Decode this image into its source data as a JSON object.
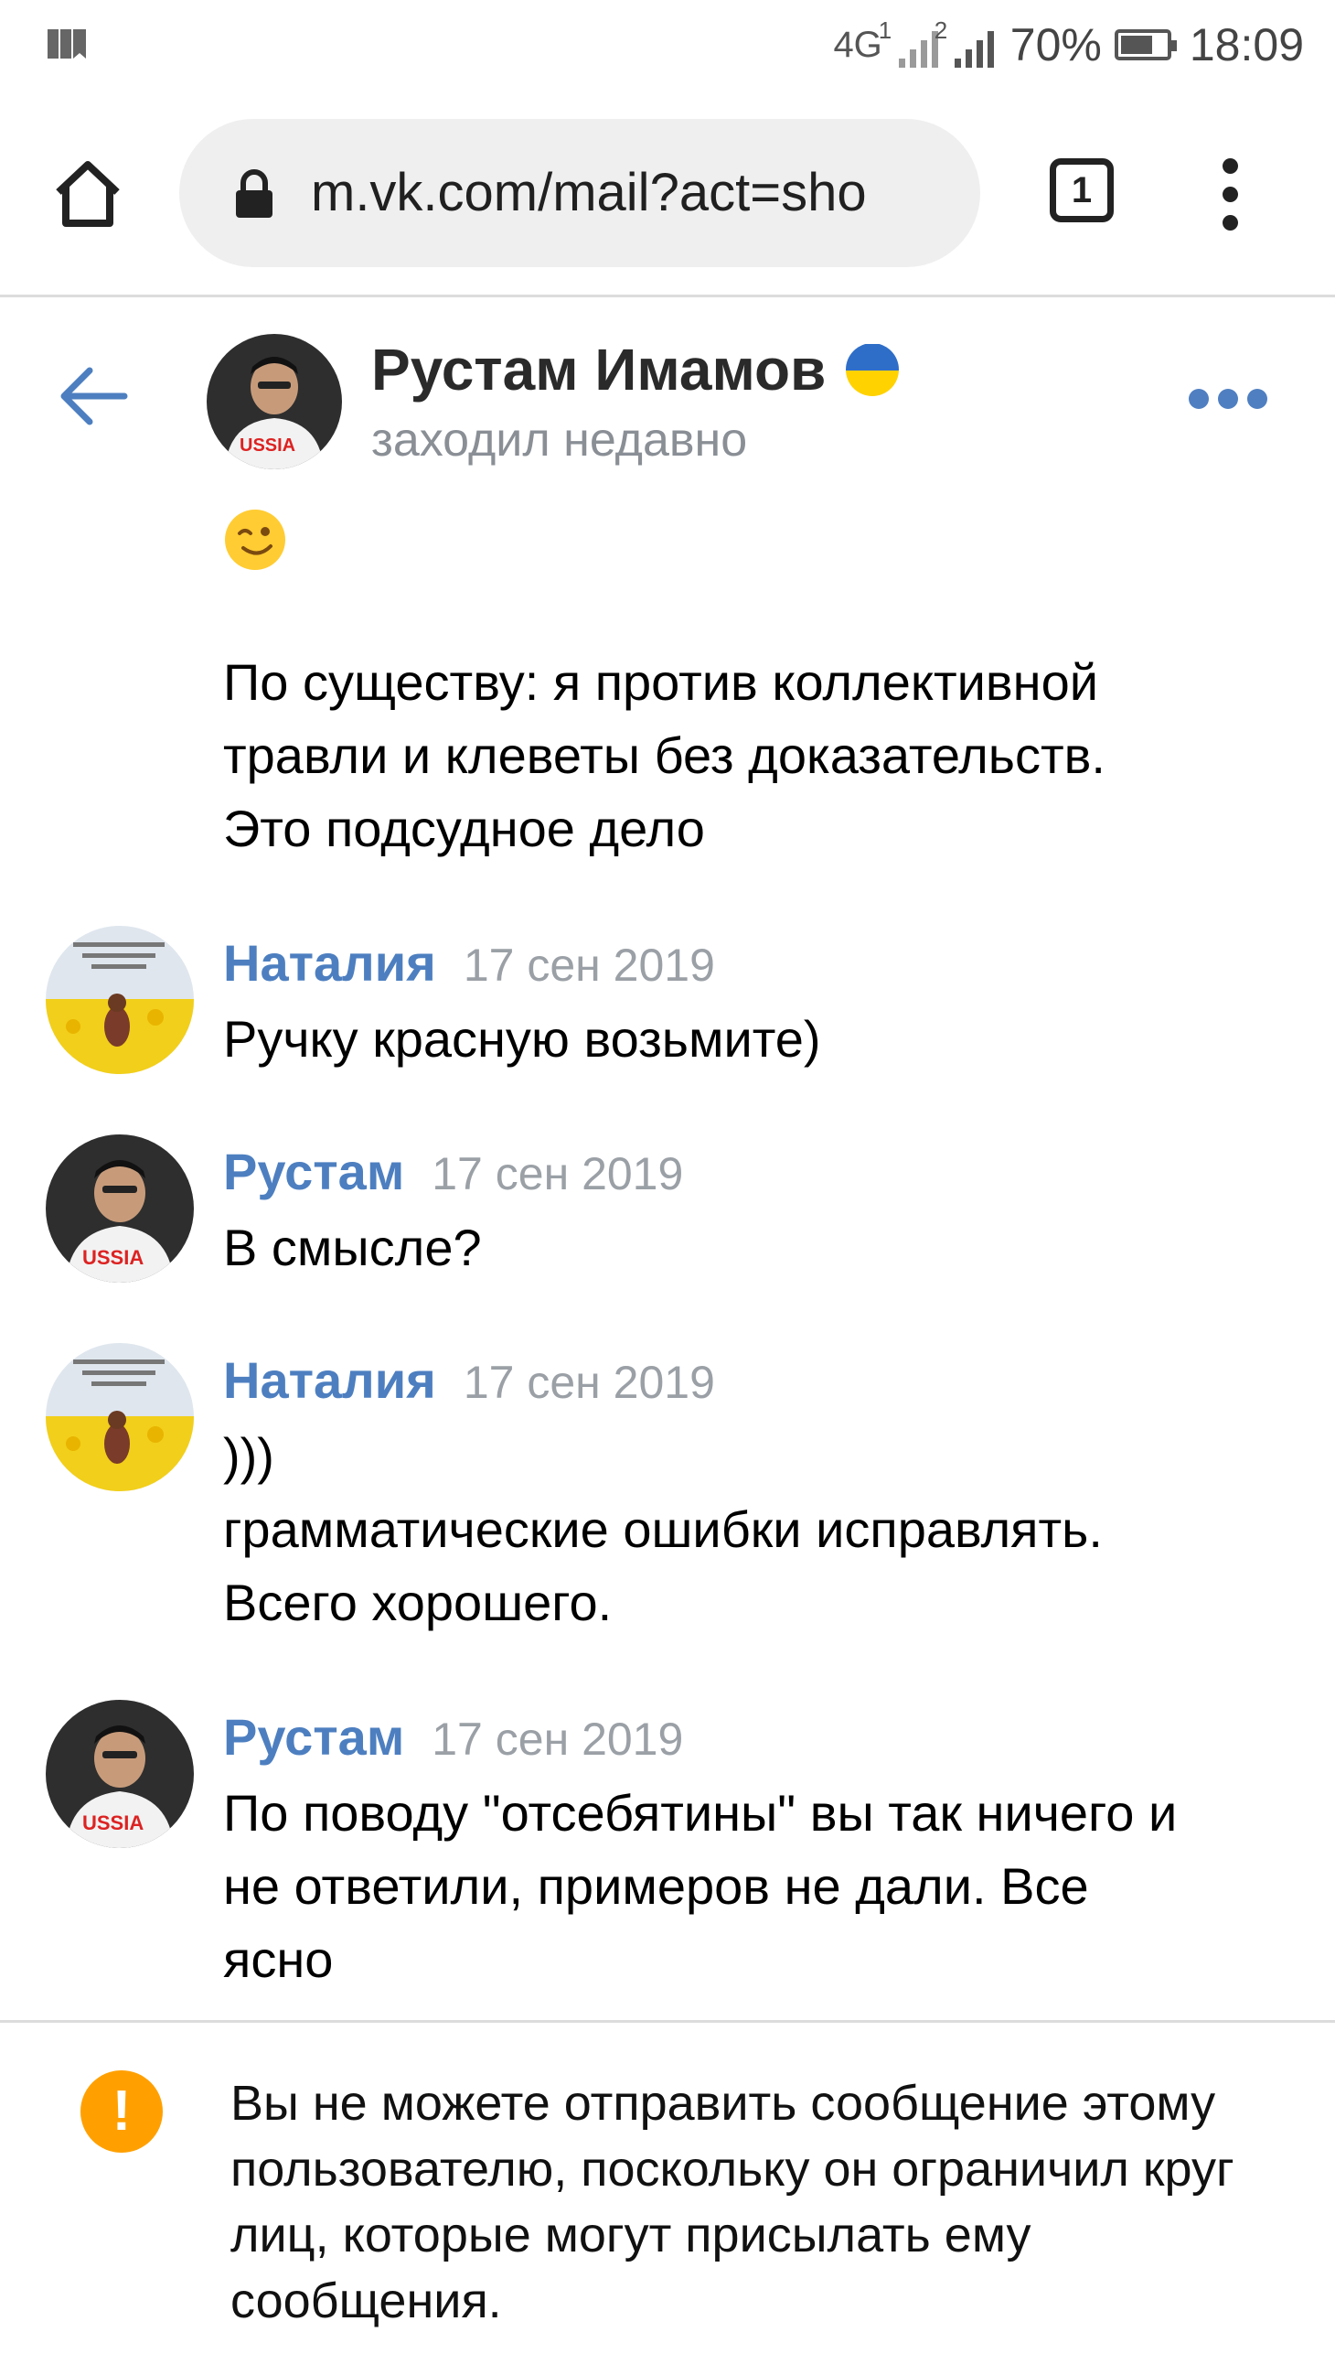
{
  "status_bar": {
    "network": "4G",
    "sim1": "1",
    "sim2": "2",
    "battery_percent_text": "70%",
    "battery_level": 0.7,
    "time": "18:09"
  },
  "browser": {
    "url": "m.vk.com/mail?act=sho",
    "tab_count": "1"
  },
  "chat_header": {
    "name": "Рустам Имамов",
    "status": "заходил недавно"
  },
  "top_message": {
    "emoji": "winking-face",
    "text": "По существу: я против коллективной\nтравли и клеветы без доказательств.\nЭто подсудное дело"
  },
  "messages": [
    {
      "author": "Наталия",
      "date": "17 сен 2019",
      "text": "Ручку красную возьмите)"
    },
    {
      "author": "Рустам",
      "date": "17 сен 2019",
      "text": "В смысле?"
    },
    {
      "author": "Наталия",
      "date": "17 сен 2019",
      "text": ")))\nграмматические ошибки исправлять.\nВсего хорошего."
    },
    {
      "author": "Рустам",
      "date": "17 сен 2019",
      "text": "По поводу \"отсебятины\" вы так ничего и\nне ответили, примеров не дали. Все\nясно"
    }
  ],
  "notice": {
    "icon": "!",
    "text": "Вы не можете отправить сообщение этому пользователю, поскольку он ограничил круг лиц, которые могут присылать ему сообщения."
  },
  "colors": {
    "link_blue": "#4d7fc0",
    "warning_orange": "#ffa000",
    "muted_gray": "#9aa0a6"
  }
}
